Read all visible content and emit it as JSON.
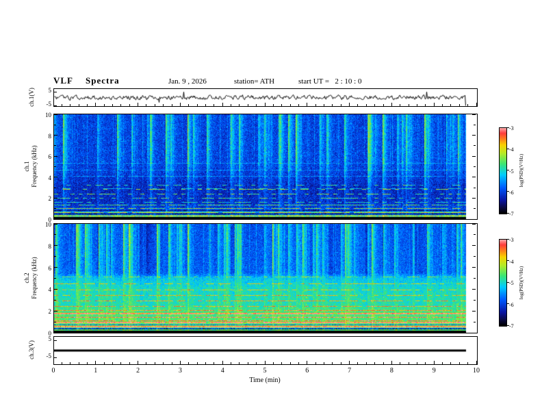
{
  "title": "VLF  Spectra",
  "header": {
    "date": "Jan. 9 , 2026",
    "station": "station= ATH",
    "start_ut": "start UT =   2 : 10 : 0"
  },
  "xaxis": {
    "label": "Time (min)",
    "range": [
      0,
      10
    ],
    "ticks": [
      0,
      1,
      2,
      3,
      4,
      5,
      6,
      7,
      8,
      9,
      10
    ]
  },
  "colorbar": {
    "label": "log(PSD)(V²/Hz)",
    "ticks": [
      -3,
      -4,
      -5,
      -6,
      -7
    ],
    "range": [
      -7,
      -3
    ]
  },
  "chart_data": [
    {
      "id": "ch1_wave",
      "type": "line",
      "ylabel": "ch.1(V)",
      "ylim": [
        -5,
        5
      ],
      "yticks": [
        5,
        -5
      ],
      "description": "Broadband noisy waveform around 0 V, ~±1 V, with sporadic impulsive spikes reaching ±5 V across the full 0–10 min record",
      "seed": 31,
      "extent": 0.975,
      "flat": false
    },
    {
      "id": "ch1_spec",
      "type": "heatmap",
      "ylabel1": "ch.1",
      "ylabel2": "Frequency (kHz)",
      "ylim": [
        0,
        10
      ],
      "yticks": [
        10,
        8,
        6,
        4,
        2,
        0
      ],
      "yticks_minor": [
        9,
        7,
        5,
        3,
        1
      ],
      "colorbar_range": [
        -7,
        -3
      ],
      "description": "Spectrogram 0-10 kHz: blue background (~-6.3) with dense broadband vertical impulse streaks (green/cyan ~-5) strongest above 4 kHz; yellow/red narrowband horizontal lines below ~3 kHz; black band at 0 kHz",
      "seed": 7,
      "extent": 0.975,
      "streak_prob": 0.085,
      "streak_max": 0.38,
      "noise": 0.09,
      "black_bottom": 3,
      "base_profile": [
        [
          10,
          0.25
        ],
        [
          5.5,
          0.25
        ],
        [
          4,
          0.22
        ],
        [
          3,
          0.19
        ],
        [
          1.5,
          0.2
        ],
        [
          0.8,
          0.25
        ],
        [
          0,
          0.29
        ]
      ],
      "vert_profile": [
        [
          10,
          1
        ],
        [
          6,
          0.92
        ],
        [
          4,
          0.55
        ],
        [
          2,
          0.35
        ],
        [
          0,
          0.3
        ]
      ],
      "lines": [
        [
          0.12,
          0.45,
          1.0
        ],
        [
          0.25,
          0.5,
          1.0
        ],
        [
          0.45,
          -0.2,
          1.0
        ],
        [
          0.6,
          0.45,
          0.95
        ],
        [
          0.8,
          -0.15,
          1.0
        ],
        [
          1.0,
          0.4,
          0.9
        ],
        [
          1.3,
          0.35,
          0.75
        ],
        [
          1.6,
          0.3,
          0.6
        ],
        [
          2.0,
          0.35,
          0.5
        ],
        [
          2.4,
          0.4,
          0.45
        ],
        [
          2.8,
          0.45,
          0.4
        ],
        [
          3.2,
          0.3,
          0.35
        ],
        [
          4.1,
          0.13,
          0.9
        ],
        [
          4.7,
          0.11,
          0.9
        ],
        [
          5.3,
          0.1,
          0.85
        ]
      ]
    },
    {
      "id": "ch2_spec",
      "type": "heatmap",
      "ylabel1": "ch.2",
      "ylabel2": "Frequency (kHz)",
      "ylim": [
        0,
        10
      ],
      "yticks": [
        10,
        8,
        6,
        4,
        2,
        0
      ],
      "yticks_minor": [
        9,
        7,
        5,
        3,
        1
      ],
      "colorbar_range": [
        -7,
        -3
      ],
      "description": "Spectrogram 0-10 kHz: blue with green vertical streaks above ~5 kHz; green/cyan diffuse band 2-5 kHz; yellow-green with strong yellow/red horizontal interference lines below 2 kHz; black band at 0 kHz",
      "seed": 99,
      "extent": 0.975,
      "streak_prob": 0.08,
      "streak_max": 0.34,
      "noise": 0.08,
      "black_bottom": 3,
      "dark_prob": 0.05,
      "dark_max": 0.16,
      "base_profile": [
        [
          10,
          0.28
        ],
        [
          5.5,
          0.3
        ],
        [
          5,
          0.44
        ],
        [
          4,
          0.5
        ],
        [
          2.5,
          0.52
        ],
        [
          2,
          0.57
        ],
        [
          0.5,
          0.6
        ],
        [
          0,
          0.55
        ]
      ],
      "vert_profile": [
        [
          10,
          1
        ],
        [
          5.5,
          0.8
        ],
        [
          5,
          0.3
        ],
        [
          0,
          0.2
        ]
      ],
      "lines": [
        [
          0.15,
          0.4,
          1.0
        ],
        [
          0.3,
          -0.5,
          1.0
        ],
        [
          0.5,
          0.45,
          1.0
        ],
        [
          0.7,
          -0.3,
          1.0
        ],
        [
          0.9,
          0.5,
          0.95
        ],
        [
          1.1,
          0.3,
          0.9
        ],
        [
          1.4,
          0.35,
          0.9
        ],
        [
          1.7,
          0.5,
          0.95
        ],
        [
          2.0,
          0.3,
          0.85
        ],
        [
          2.4,
          0.32,
          0.8
        ],
        [
          2.9,
          0.3,
          0.75
        ],
        [
          3.4,
          0.28,
          0.7
        ],
        [
          3.9,
          0.26,
          0.7
        ],
        [
          4.5,
          0.28,
          0.6
        ],
        [
          5.1,
          0.2,
          0.5
        ]
      ]
    },
    {
      "id": "ch3_wave",
      "type": "line",
      "ylabel": "ch.3(V)",
      "ylim": [
        -5,
        5
      ],
      "yticks": [
        5,
        -5
      ],
      "description": "Flat line at 0 V for the full record (no signal on channel 3)",
      "seed": 5,
      "extent": 0.975,
      "flat": true
    }
  ]
}
